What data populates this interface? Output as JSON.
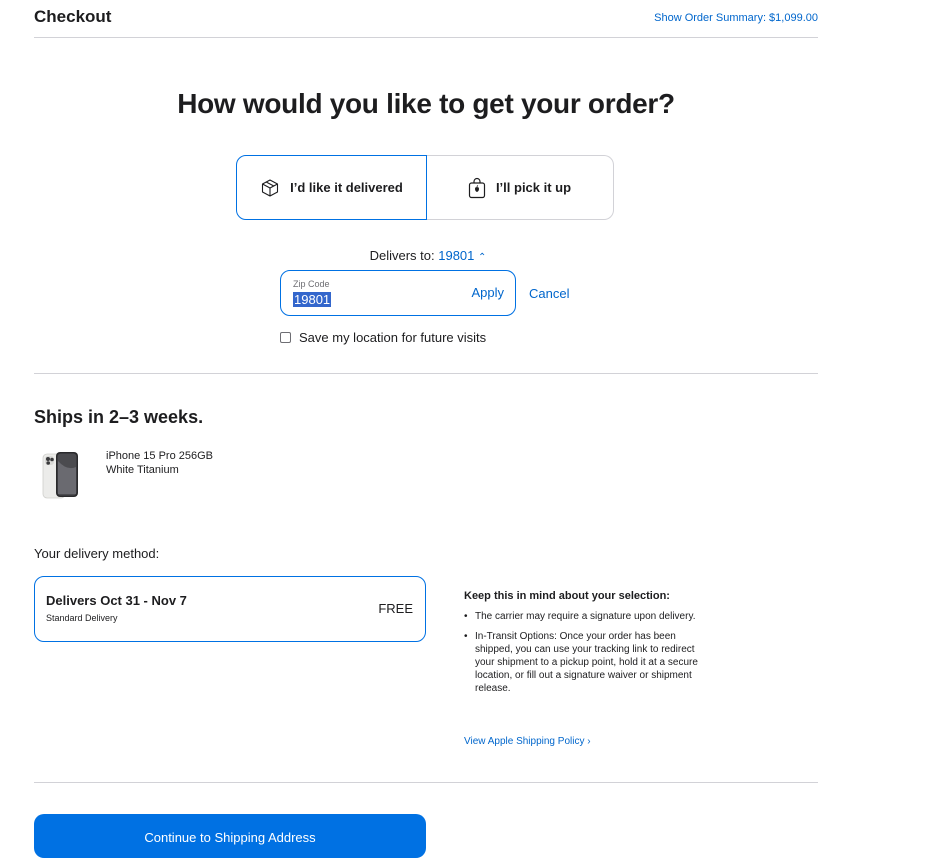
{
  "header": {
    "title": "Checkout",
    "order_summary_label": "Show Order Summary: $1,099.00"
  },
  "headline": "How would you like to get your order?",
  "fulfillment_options": {
    "delivery_label": "I’d like it delivered",
    "pickup_label": "I’ll pick it up",
    "selected": "delivery",
    "delivery_icon": "box-icon",
    "pickup_icon": "shopping-bag-icon"
  },
  "location": {
    "delivers_to_prefix": "Delivers to:",
    "zip_link": "19801",
    "zip_field_label": "Zip Code",
    "zip_value": "19801",
    "apply_label": "Apply",
    "cancel_label": "Cancel",
    "save_location_label": "Save my location for future visits",
    "save_location_checked": false
  },
  "shipping": {
    "ships_heading": "Ships in 2–3 weeks.",
    "product_name": "iPhone 15 Pro 256GB",
    "product_color": "White Titanium"
  },
  "delivery_method": {
    "label": "Your delivery method:",
    "option_title": "Delivers Oct 31 - Nov 7",
    "option_subtitle": "Standard Delivery",
    "option_price": "FREE"
  },
  "info": {
    "title": "Keep this in mind about your selection:",
    "bullets": [
      "The carrier may require a signature upon delivery.",
      "In-Transit Options: Once your order has been shipped, you can use your tracking link to redirect your shipment to a pickup point, hold it at a secure location, or fill out a signature waiver or shipment release."
    ],
    "policy_link": "View Apple Shipping Policy ›"
  },
  "continue_button": "Continue to Shipping Address",
  "colors": {
    "accent": "#0071e3",
    "link": "#0066cc",
    "text": "#1d1d1f",
    "divider": "#d2d2d7"
  }
}
